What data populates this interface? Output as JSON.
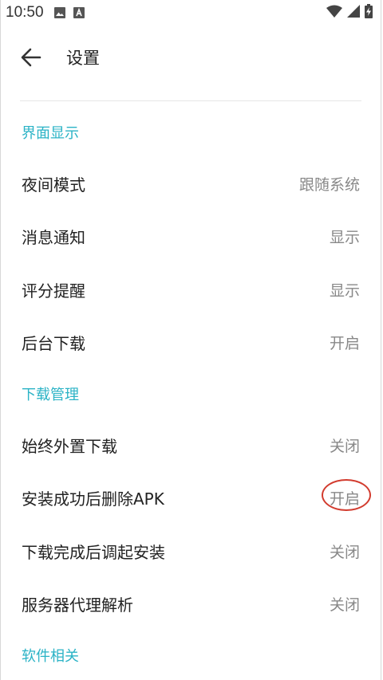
{
  "status_bar": {
    "time": "10:50",
    "icons_left": [
      "image-icon",
      "a-letter-icon"
    ],
    "icons_right": [
      "wifi-icon",
      "signal-icon",
      "battery-charging-icon"
    ]
  },
  "app_bar": {
    "title": "设置",
    "back_icon": "back-arrow-icon"
  },
  "sections": [
    {
      "header": "界面显示",
      "items": [
        {
          "label": "夜间模式",
          "value": "跟随系统"
        },
        {
          "label": "消息通知",
          "value": "显示"
        },
        {
          "label": "评分提醒",
          "value": "显示"
        },
        {
          "label": "后台下载",
          "value": "开启"
        }
      ]
    },
    {
      "header": "下载管理",
      "items": [
        {
          "label": "始终外置下载",
          "value": "关闭"
        },
        {
          "label": "安装成功后删除APK",
          "value": "开启"
        },
        {
          "label": "下载完成后调起安装",
          "value": "关闭"
        },
        {
          "label": "服务器代理解析",
          "value": "关闭"
        }
      ]
    },
    {
      "header": "软件相关",
      "items": []
    }
  ],
  "colors": {
    "section_accent": "#2bb3c6",
    "highlight_ring": "#d23b2e"
  }
}
